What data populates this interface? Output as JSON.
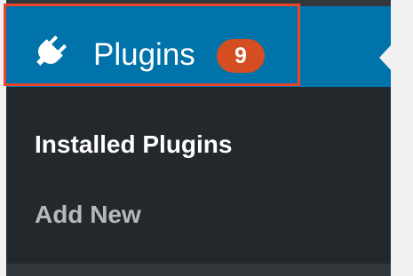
{
  "menu": {
    "title": "Plugins",
    "icon": "plugin-icon",
    "badge_count": "9",
    "colors": {
      "menu_bg": "#32373c",
      "active_bg": "#0073aa",
      "submenu_bg": "#23282d",
      "badge_bg": "#d54e21",
      "highlight": "#f0442a"
    }
  },
  "submenu": {
    "items": [
      {
        "label": "Installed Plugins",
        "current": true
      },
      {
        "label": "Add New",
        "current": false
      }
    ]
  }
}
